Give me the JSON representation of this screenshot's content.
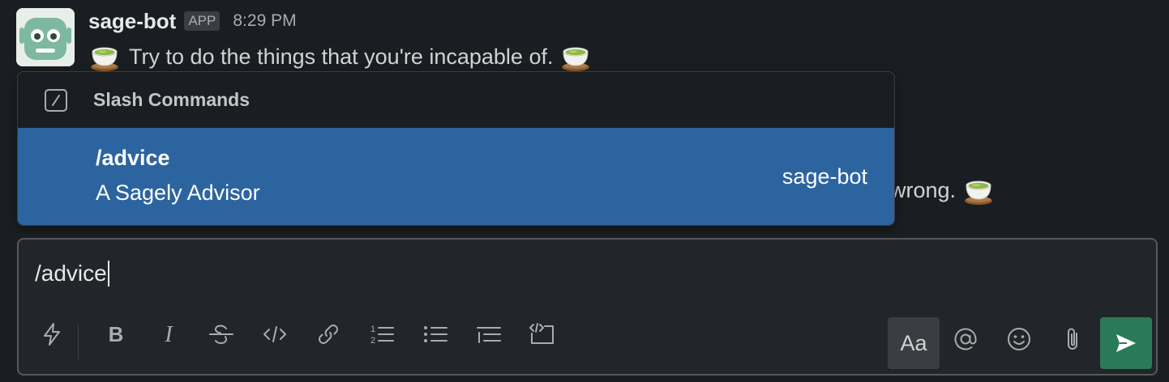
{
  "message": {
    "sender": "sage-bot",
    "badge": "APP",
    "timestamp": "8:29 PM",
    "text": "Try to do the things that you're incapable of."
  },
  "message2": {
    "visible_tail": "wrong."
  },
  "slash_popup": {
    "title": "Slash Commands",
    "commands": [
      {
        "name": "/advice",
        "description": "A Sagely Advisor",
        "app": "sage-bot"
      }
    ]
  },
  "composer": {
    "value": "/advice",
    "format_label": "Aa"
  },
  "colors": {
    "background": "#1a1d21",
    "selected_row": "#2c64a0",
    "send_button": "#2b7a57",
    "composer_border": "#55585d"
  },
  "icons": {
    "toolbar": [
      "shortcuts-icon",
      "bold-icon",
      "italic-icon",
      "strikethrough-icon",
      "code-icon",
      "link-icon",
      "numbered-list-icon",
      "bulleted-list-icon",
      "blockquote-icon",
      "code-block-icon",
      "mention-icon",
      "emoji-icon",
      "attachment-icon",
      "send-icon"
    ],
    "emoji": "tea-cup-emoji"
  }
}
